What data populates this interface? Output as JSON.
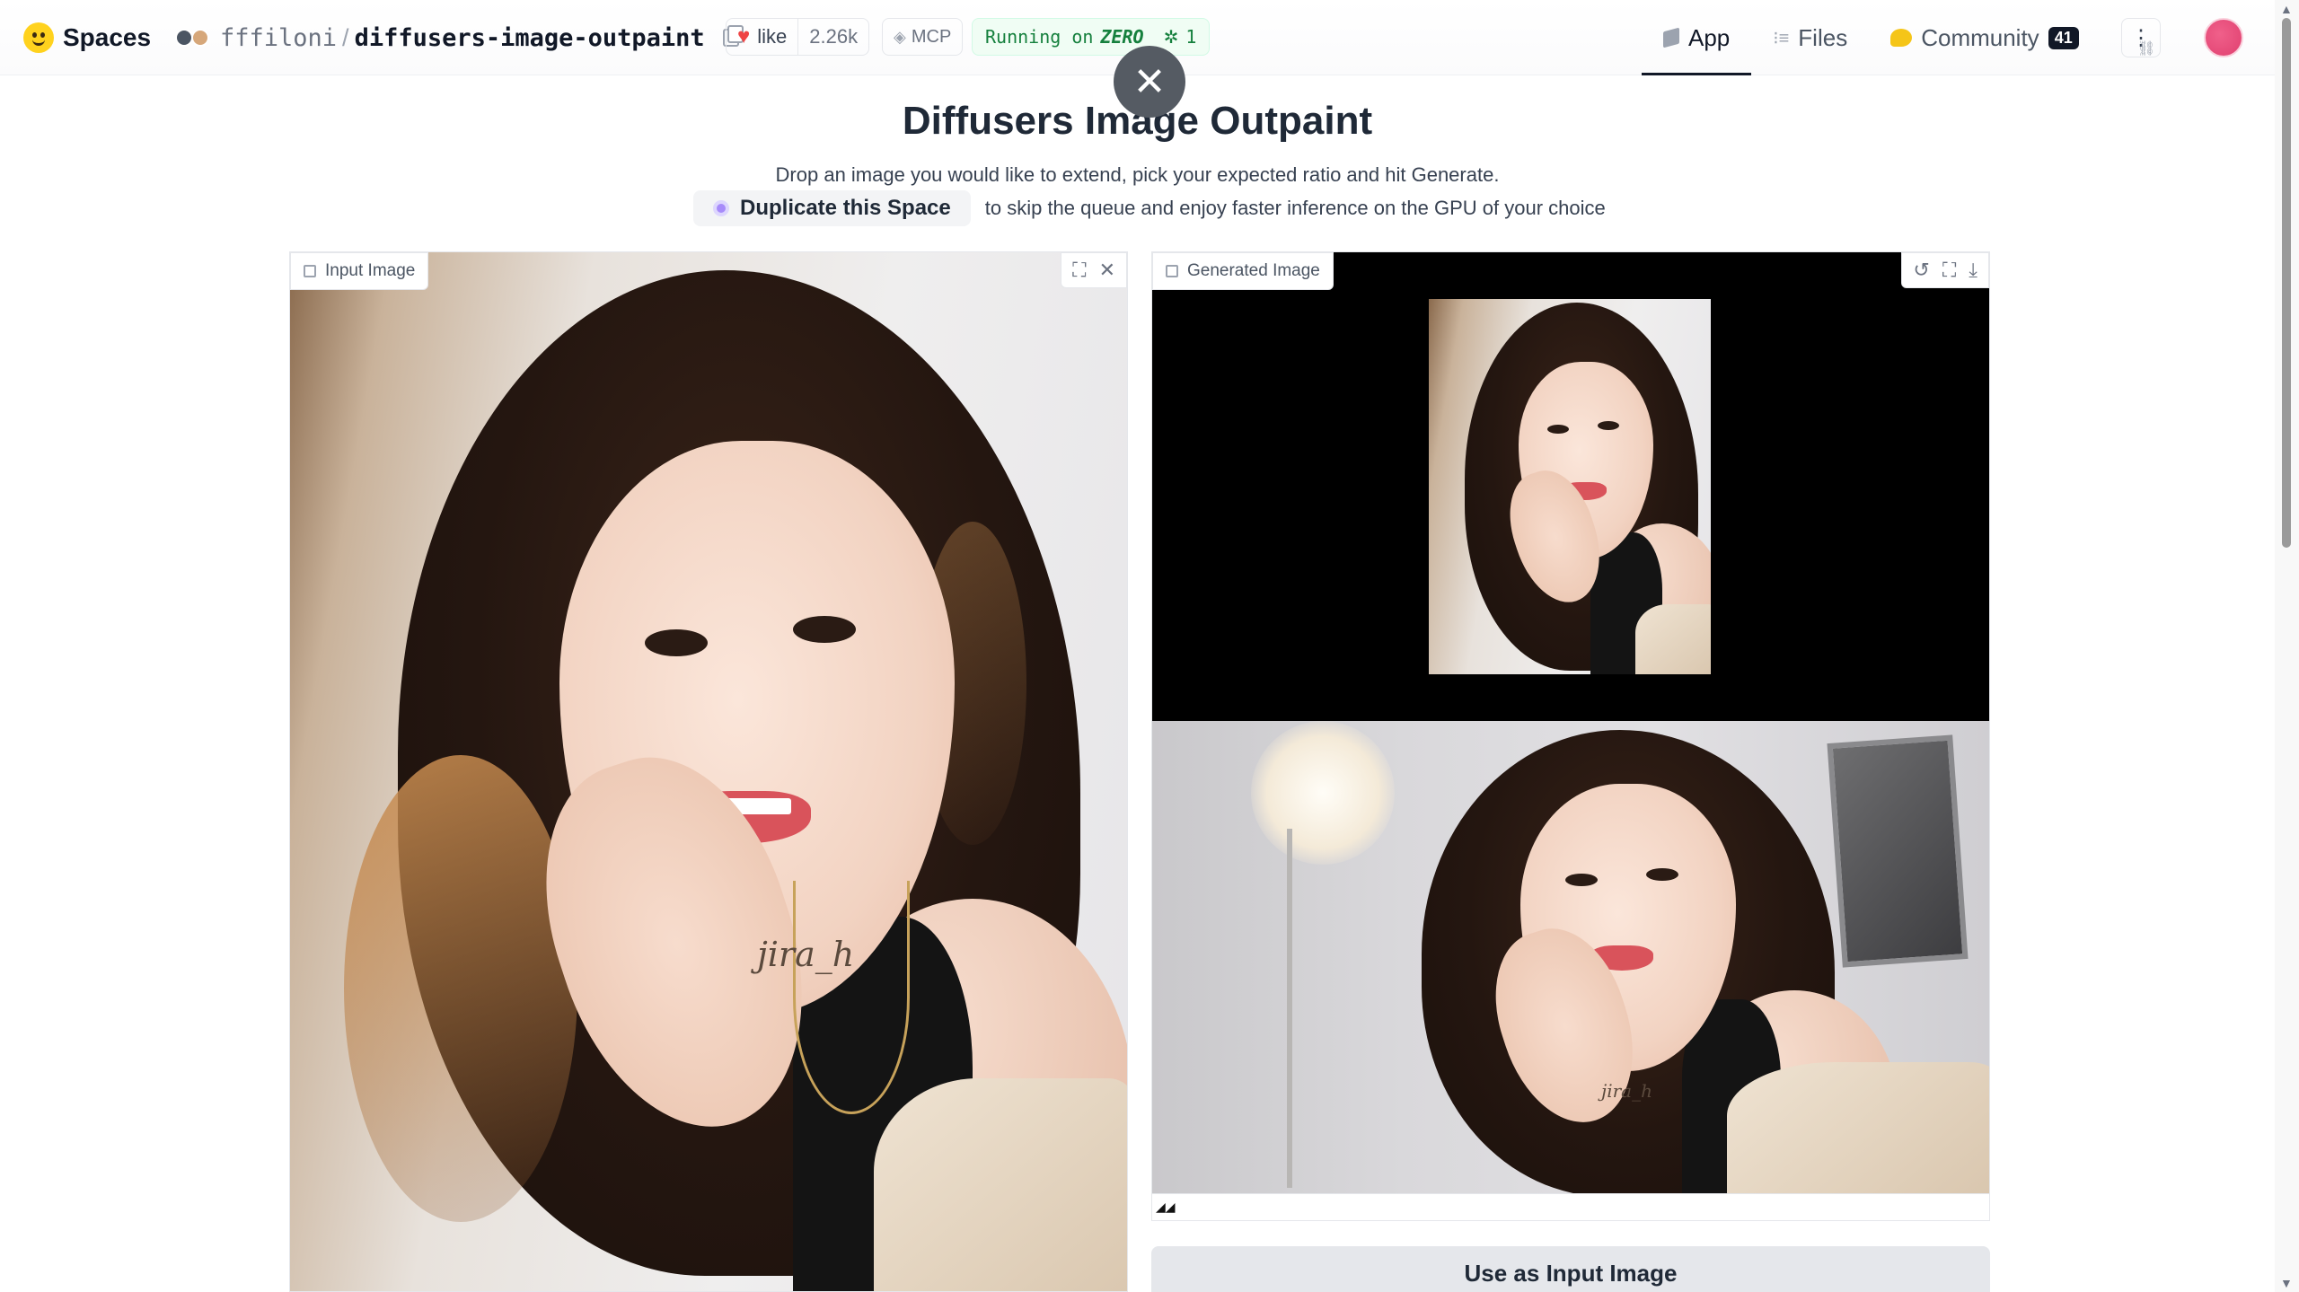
{
  "brand": {
    "name": "Spaces"
  },
  "repo": {
    "owner": "fffiloni",
    "separator": "/",
    "name": "diffusers-image-outpaint"
  },
  "like": {
    "label": "like",
    "count": "2.26k"
  },
  "mcp": {
    "label": "MCP"
  },
  "status": {
    "prefix": "Running on",
    "hardware": "ZERO",
    "replicas": "1"
  },
  "nav": {
    "tabs": [
      {
        "label": "App",
        "icon": "app-icon",
        "active": true
      },
      {
        "label": "Files",
        "icon": "files-icon",
        "active": false
      },
      {
        "label": "Community",
        "icon": "community-icon",
        "active": false,
        "badge": "41"
      }
    ],
    "more_icon": "⋮"
  },
  "overlay": {
    "close_glyph": "✕"
  },
  "page": {
    "title": "Diffusers Image Outpaint",
    "subtitle": "Drop an image you would like to extend, pick your expected ratio and hit Generate.",
    "duplicate_label": "Duplicate this Space",
    "duplicate_suffix": "to skip the queue and enjoy faster inference on the GPU of your choice"
  },
  "input_panel": {
    "label": "Input Image",
    "fullscreen_glyph": "⛶",
    "close_glyph": "✕",
    "signature": "jira_h"
  },
  "output_panel": {
    "label": "Generated Image",
    "undo_glyph": "↺",
    "fullscreen_glyph": "⛶",
    "download_glyph": "⤓",
    "footer_glyph": "◢◢",
    "signature": "jira_h"
  },
  "actions": {
    "use_as_input": "Use as Input Image"
  },
  "colors": {
    "accent": "#ffd21e",
    "status_green": "#15803d",
    "heart": "#ef4444"
  }
}
